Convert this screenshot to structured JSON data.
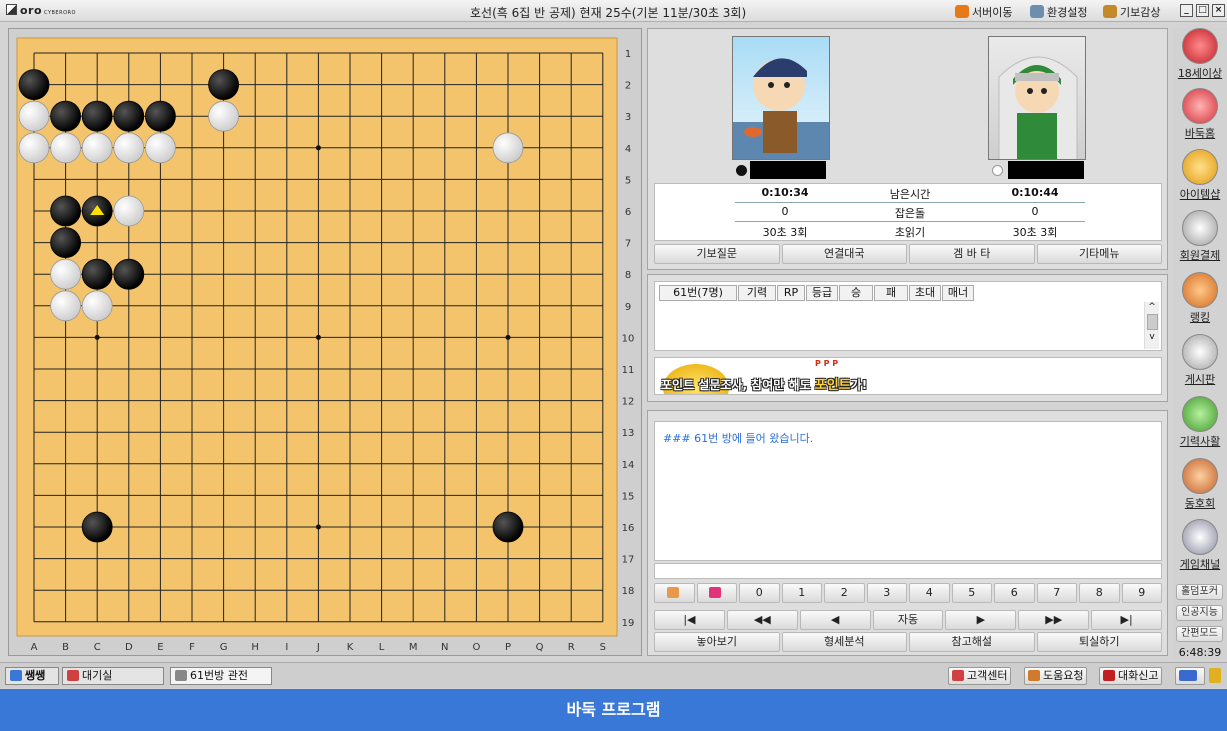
{
  "titlebar": {
    "logo": "oro",
    "logo_small": "CYBERORO",
    "title": "호선(흑 6집 반 공제) 현재 25수(기본 11분/30초 3회)",
    "links": [
      "서버이동",
      "환경설정",
      "기보감상"
    ]
  },
  "board": {
    "size": 19,
    "cols": [
      "A",
      "B",
      "C",
      "D",
      "E",
      "F",
      "G",
      "H",
      "I",
      "J",
      "K",
      "L",
      "M",
      "N",
      "O",
      "P",
      "Q",
      "R",
      "S"
    ],
    "rows": [
      "1",
      "2",
      "3",
      "4",
      "5",
      "6",
      "7",
      "8",
      "9",
      "10",
      "11",
      "12",
      "13",
      "14",
      "15",
      "16",
      "17",
      "18",
      "19"
    ],
    "stones": [
      {
        "c": "A",
        "r": 2,
        "color": "B"
      },
      {
        "c": "G",
        "r": 2,
        "color": "B"
      },
      {
        "c": "A",
        "r": 3,
        "color": "W"
      },
      {
        "c": "B",
        "r": 3,
        "color": "B"
      },
      {
        "c": "C",
        "r": 3,
        "color": "B"
      },
      {
        "c": "D",
        "r": 3,
        "color": "B"
      },
      {
        "c": "E",
        "r": 3,
        "color": "B"
      },
      {
        "c": "G",
        "r": 3,
        "color": "W"
      },
      {
        "c": "A",
        "r": 4,
        "color": "W"
      },
      {
        "c": "B",
        "r": 4,
        "color": "W"
      },
      {
        "c": "C",
        "r": 4,
        "color": "W"
      },
      {
        "c": "D",
        "r": 4,
        "color": "W"
      },
      {
        "c": "E",
        "r": 4,
        "color": "W"
      },
      {
        "c": "P",
        "r": 4,
        "color": "W"
      },
      {
        "c": "B",
        "r": 6,
        "color": "B"
      },
      {
        "c": "C",
        "r": 6,
        "color": "B",
        "last": true
      },
      {
        "c": "D",
        "r": 6,
        "color": "W"
      },
      {
        "c": "B",
        "r": 7,
        "color": "B"
      },
      {
        "c": "B",
        "r": 8,
        "color": "W"
      },
      {
        "c": "C",
        "r": 8,
        "color": "B"
      },
      {
        "c": "D",
        "r": 8,
        "color": "B"
      },
      {
        "c": "B",
        "r": 9,
        "color": "W"
      },
      {
        "c": "C",
        "r": 9,
        "color": "W"
      },
      {
        "c": "C",
        "r": 16,
        "color": "B"
      },
      {
        "c": "P",
        "r": 16,
        "color": "B"
      }
    ],
    "star_points": [
      [
        "C",
        4
      ],
      [
        "J",
        4
      ],
      [
        "P",
        4
      ],
      [
        "C",
        10
      ],
      [
        "J",
        10
      ],
      [
        "P",
        10
      ],
      [
        "C",
        16
      ],
      [
        "J",
        16
      ],
      [
        "P",
        16
      ]
    ]
  },
  "players": {
    "black": {
      "time": "0:10:34",
      "captured": "0",
      "byoyomi": "30초 3회"
    },
    "white": {
      "time": "0:10:44",
      "captured": "0",
      "byoyomi": "30초 3회"
    },
    "labels": {
      "time": "남은시간",
      "captured": "잡은돌",
      "byoyomi": "초읽기"
    }
  },
  "game_buttons": [
    "기보질문",
    "연결대국",
    "겜 바 타",
    "기타메뉴"
  ],
  "user_list": {
    "headers": [
      "61번(7명)",
      "기력",
      "RP",
      "등급",
      "승",
      "패",
      "초대",
      "매너"
    ]
  },
  "banner": {
    "text": "포인트 설문조사, 참여만 해도 ",
    "highlight": "포인트",
    "suffix": "가!",
    "dots": "P P P"
  },
  "chat": {
    "line": "### 61번 방에 들어 왔습니다."
  },
  "nav_numbers": [
    "0",
    "1",
    "2",
    "3",
    "4",
    "5",
    "6",
    "7",
    "8",
    "9"
  ],
  "playback": {
    "auto": "자동"
  },
  "analysis_buttons": [
    "놓아보기",
    "형세분석",
    "참고해설",
    "퇴실하기"
  ],
  "sidebar": {
    "items": [
      "18세이상",
      "바둑홈",
      "아이템샵",
      "회원결제",
      "랭킹",
      "게시판",
      "기력사활",
      "동호회",
      "게임채널"
    ],
    "buttons": [
      "홀덤포커",
      "인공지능",
      "간편모드"
    ],
    "clock": "6:48:39"
  },
  "statusbar": {
    "tabs": [
      "쌩쌩",
      "대기실",
      "61번방 관전"
    ],
    "right_buttons": [
      "고객센터",
      "도움요청",
      "대화신고"
    ]
  },
  "caption": "바둑 프로그램",
  "colors": {
    "board": "#f3c46c",
    "accent": "#3a78d8",
    "chat_text": "#2b6fd6"
  }
}
